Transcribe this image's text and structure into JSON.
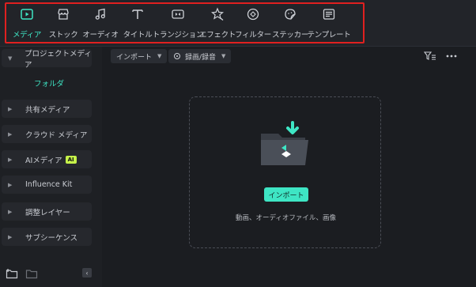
{
  "toolbar": {
    "tools": [
      {
        "label": "メディア",
        "icon": "media-icon",
        "active": true
      },
      {
        "label": "ストック",
        "icon": "stock-icon",
        "active": false
      },
      {
        "label": "オーディオ",
        "icon": "audio-icon",
        "active": false
      },
      {
        "label": "タイトル",
        "icon": "title-icon",
        "active": false
      },
      {
        "label": "トランジション",
        "icon": "transition-icon",
        "active": false
      },
      {
        "label": "エフェクト",
        "icon": "effect-icon",
        "active": false
      },
      {
        "label": "フィルター",
        "icon": "filter-icon",
        "active": false
      },
      {
        "label": "ステッカー",
        "icon": "sticker-icon",
        "active": false
      },
      {
        "label": "テンプレート",
        "icon": "template-icon",
        "active": false
      }
    ]
  },
  "sidebar": {
    "items": [
      {
        "label": "プロジェクトメディア",
        "expanded": true
      },
      {
        "label": "共有メディア",
        "expanded": false
      },
      {
        "label": "クラウド メディア",
        "expanded": false
      },
      {
        "label": "AIメディア",
        "badge": "AI",
        "expanded": false
      },
      {
        "label": "Influence Kit",
        "expanded": false
      },
      {
        "label": "調整レイヤー",
        "expanded": false
      },
      {
        "label": "サブシーケンス",
        "expanded": false
      }
    ],
    "folder_label": "フォルダ"
  },
  "main": {
    "import_dropdown": "インポート",
    "record_dropdown": "録画/録音",
    "import_button": "インポート",
    "import_hint": "動画、オーディオファイル、画像"
  },
  "colors": {
    "accent": "#3ee5c4",
    "highlight": "#e02020",
    "ai_badge": "#c6f24a"
  }
}
